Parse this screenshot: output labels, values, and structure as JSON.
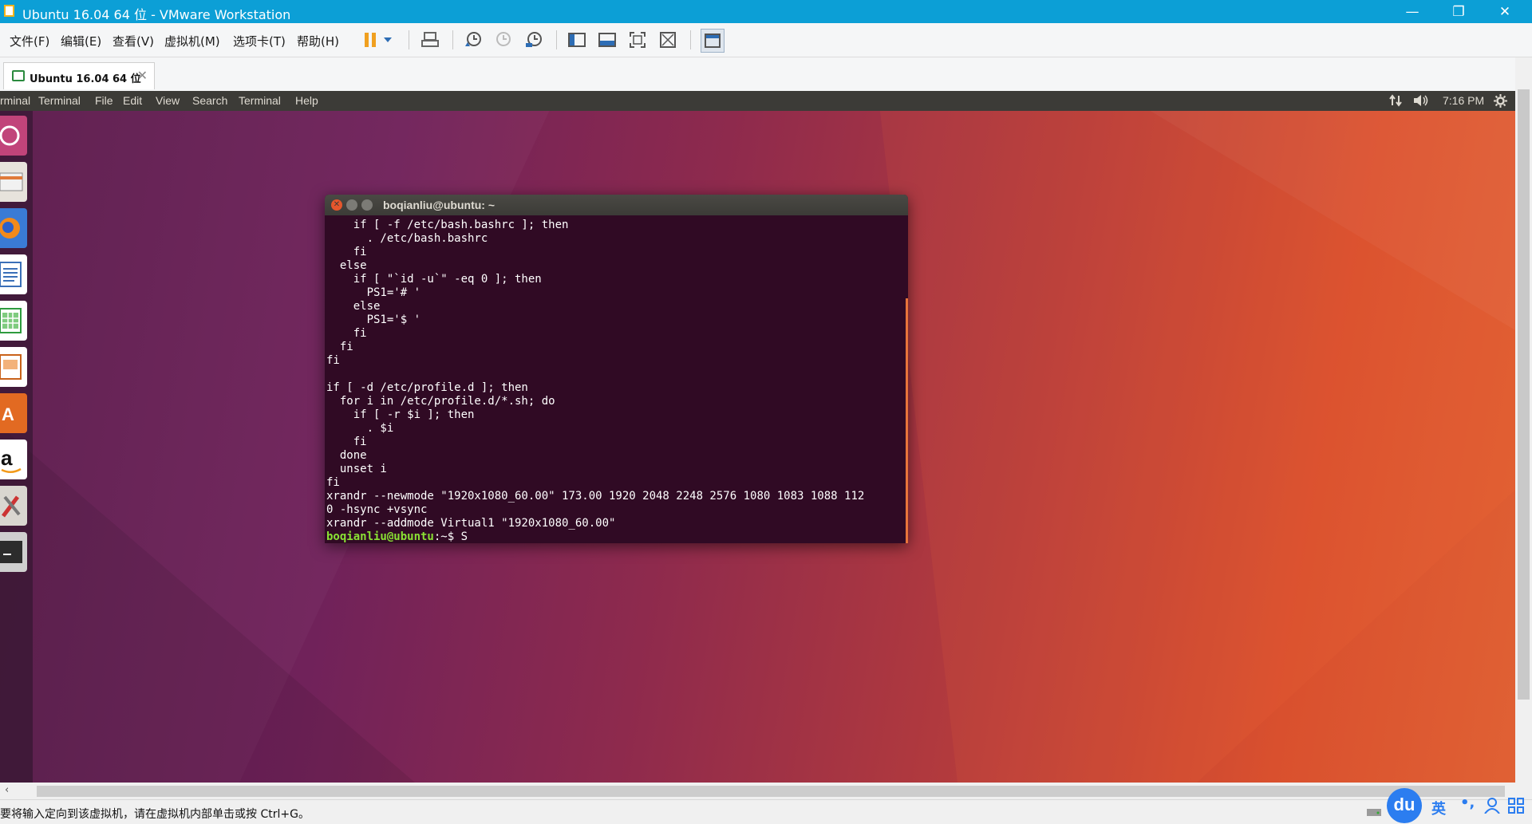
{
  "window": {
    "title": "Ubuntu 16.04 64 位 - VMware Workstation",
    "minimize": "—",
    "restore": "❐",
    "close": "✕"
  },
  "menu": [
    "文件(F)",
    "编辑(E)",
    "查看(V)",
    "虚拟机(M)",
    "选项卡(T)",
    "帮助(H)"
  ],
  "toolbar_icons": [
    "pause-icon",
    "dropdown-icon",
    "send-ctrl-alt-del-icon",
    "snapshot-take-icon",
    "snapshot-revert-icon",
    "snapshot-manager-icon",
    "library-view-icon",
    "console-view-icon",
    "fullscreen-icon",
    "unity-icon",
    "thumbnail-bar-icon"
  ],
  "tab": {
    "label": "Ubuntu 16.04 64 位",
    "close": "✕"
  },
  "ubuntu": {
    "app_name": "rminal",
    "menus": [
      "Terminal",
      "File",
      "Edit",
      "View",
      "Search",
      "Terminal",
      "Help"
    ],
    "clock": "7:16 PM",
    "indicators": [
      "network-arrows-icon",
      "volume-icon",
      "settings-gear-icon"
    ]
  },
  "terminal": {
    "title": "boqianliu@ubuntu: ~",
    "lines": [
      "    if [ -f /etc/bash.bashrc ]; then",
      "      . /etc/bash.bashrc",
      "    fi",
      "  else",
      "    if [ \"`id -u`\" -eq 0 ]; then",
      "      PS1='# '",
      "    else",
      "      PS1='$ '",
      "    fi",
      "  fi",
      "fi",
      "",
      "if [ -d /etc/profile.d ]; then",
      "  for i in /etc/profile.d/*.sh; do",
      "    if [ -r $i ]; then",
      "      . $i",
      "    fi",
      "  done",
      "  unset i",
      "fi",
      "xrandr --newmode \"1920x1080_60.00\" 173.00 1920 2048 2248 2576 1080 1083 1088 112",
      "0 -hsync +vsync",
      "xrandr --addmode Virtual1 \"1920x1080_60.00\""
    ],
    "prompt_user": "boqianliu@ubuntu",
    "prompt_rest": ":~$ ",
    "prompt_input": "S"
  },
  "launcher_icons": [
    "ubuntu-dash-icon",
    "files-icon",
    "firefox-icon",
    "libreoffice-writer-icon",
    "libreoffice-calc-icon",
    "libreoffice-impress-icon",
    "ubuntu-software-icon",
    "amazon-icon",
    "system-settings-icon",
    "terminal-icon"
  ],
  "status": {
    "message": "要将输入定向到该虚拟机，请在虚拟机内部单击或按 Ctrl+G。"
  },
  "ime": {
    "logo": "du",
    "lang": "英",
    "punct": "•,",
    "user": "user-icon",
    "grid": "grid-icon"
  }
}
